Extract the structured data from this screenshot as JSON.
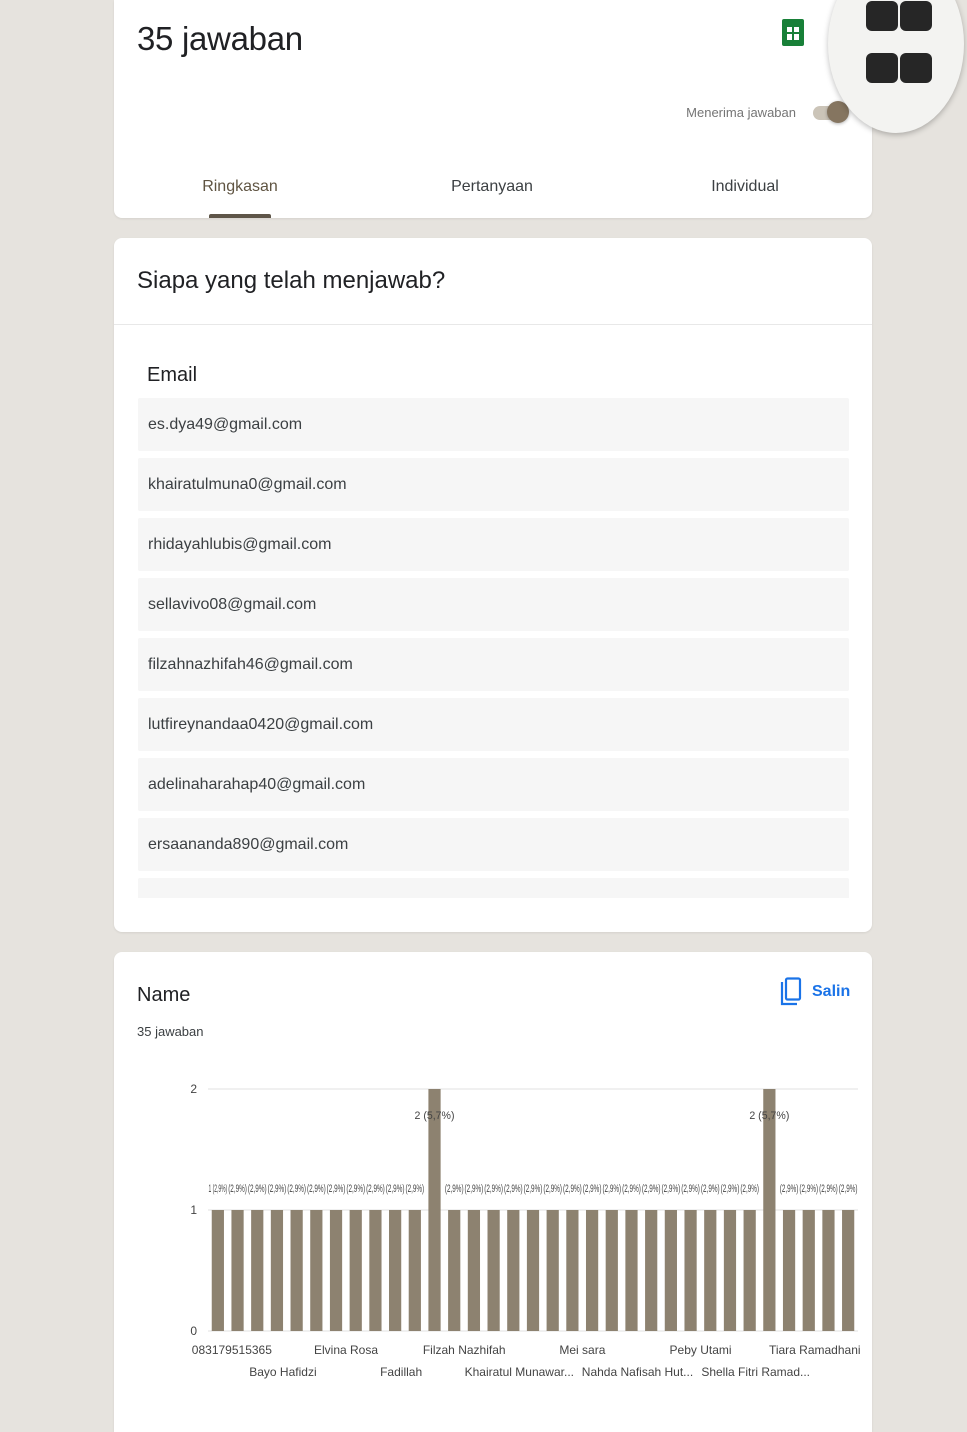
{
  "header": {
    "title": "35 jawaban",
    "accepting_label": "Menerima jawaban",
    "accepting_on": true,
    "tabs": [
      {
        "label": "Ringkasan",
        "active": true
      },
      {
        "label": "Pertanyaan",
        "active": false
      },
      {
        "label": "Individual",
        "active": false
      }
    ],
    "icons": [
      "spreadsheet-icon",
      "more-vert-icon",
      "apps-icon"
    ]
  },
  "who_responded": {
    "title": "Siapa yang telah menjawab?",
    "column_header": "Email",
    "emails": [
      "es.dya49@gmail.com",
      "khairatulmuna0@gmail.com",
      "rhidayahlubis@gmail.com",
      "sellavivo08@gmail.com",
      "filzahnazhifah46@gmail.com",
      "lutfireynandaa0420@gmail.com",
      "adelinaharahap40@gmail.com",
      "ersaananda890@gmail.com"
    ]
  },
  "name_question": {
    "title": "Name",
    "response_count": "35 jawaban",
    "copy_label": "Salin"
  },
  "chart_data": {
    "type": "bar",
    "color": "#8d8270",
    "ylim": [
      0,
      2
    ],
    "yticks": [
      "0",
      "1",
      "2"
    ],
    "values": [
      1,
      1,
      1,
      1,
      1,
      1,
      1,
      1,
      1,
      1,
      1,
      2,
      1,
      1,
      1,
      1,
      1,
      1,
      1,
      1,
      1,
      1,
      1,
      1,
      1,
      1,
      1,
      1,
      2,
      1,
      1,
      1,
      1
    ],
    "bar_labels": [
      "1 (2,9%)",
      "(2,9%)",
      "(2,9%)",
      "(2,9%)",
      "(2,9%)",
      "(2,9%)",
      "(2,9%)",
      "(2,9%)",
      "(2,9%)",
      "(2,9%)",
      "(2,9%)",
      "2 (5,7%)",
      "(2,9%)",
      "(2,9%)",
      "(2,9%)",
      "(2,9%)",
      "(2,9%)",
      "(2,9%)",
      "(2,9%)",
      "(2,9%)",
      "(2,9%)",
      "(2,9%)",
      "(2,9%)",
      "(2,9%)",
      "(2,9%)",
      "(2,9%)",
      "(2,9%)",
      "(2,9%)",
      "2 (5,7%)",
      "(2,9%)",
      "(2,9%)",
      "(2,9%)",
      "(2,9%)"
    ],
    "x_tick_labels_row1": [
      "083179515365",
      "Elvina Rosa",
      "Filzah Nazhifah",
      "Mei sara",
      "Peby Utami",
      "Tiara Ramadhani"
    ],
    "x_tick_labels_row2": [
      "Bayo Hafidzi",
      "Fadillah",
      "Khairatul Munawar...",
      "Nahda Nafisah Hut...",
      "Shella Fitri Ramad..."
    ],
    "grid": true
  }
}
